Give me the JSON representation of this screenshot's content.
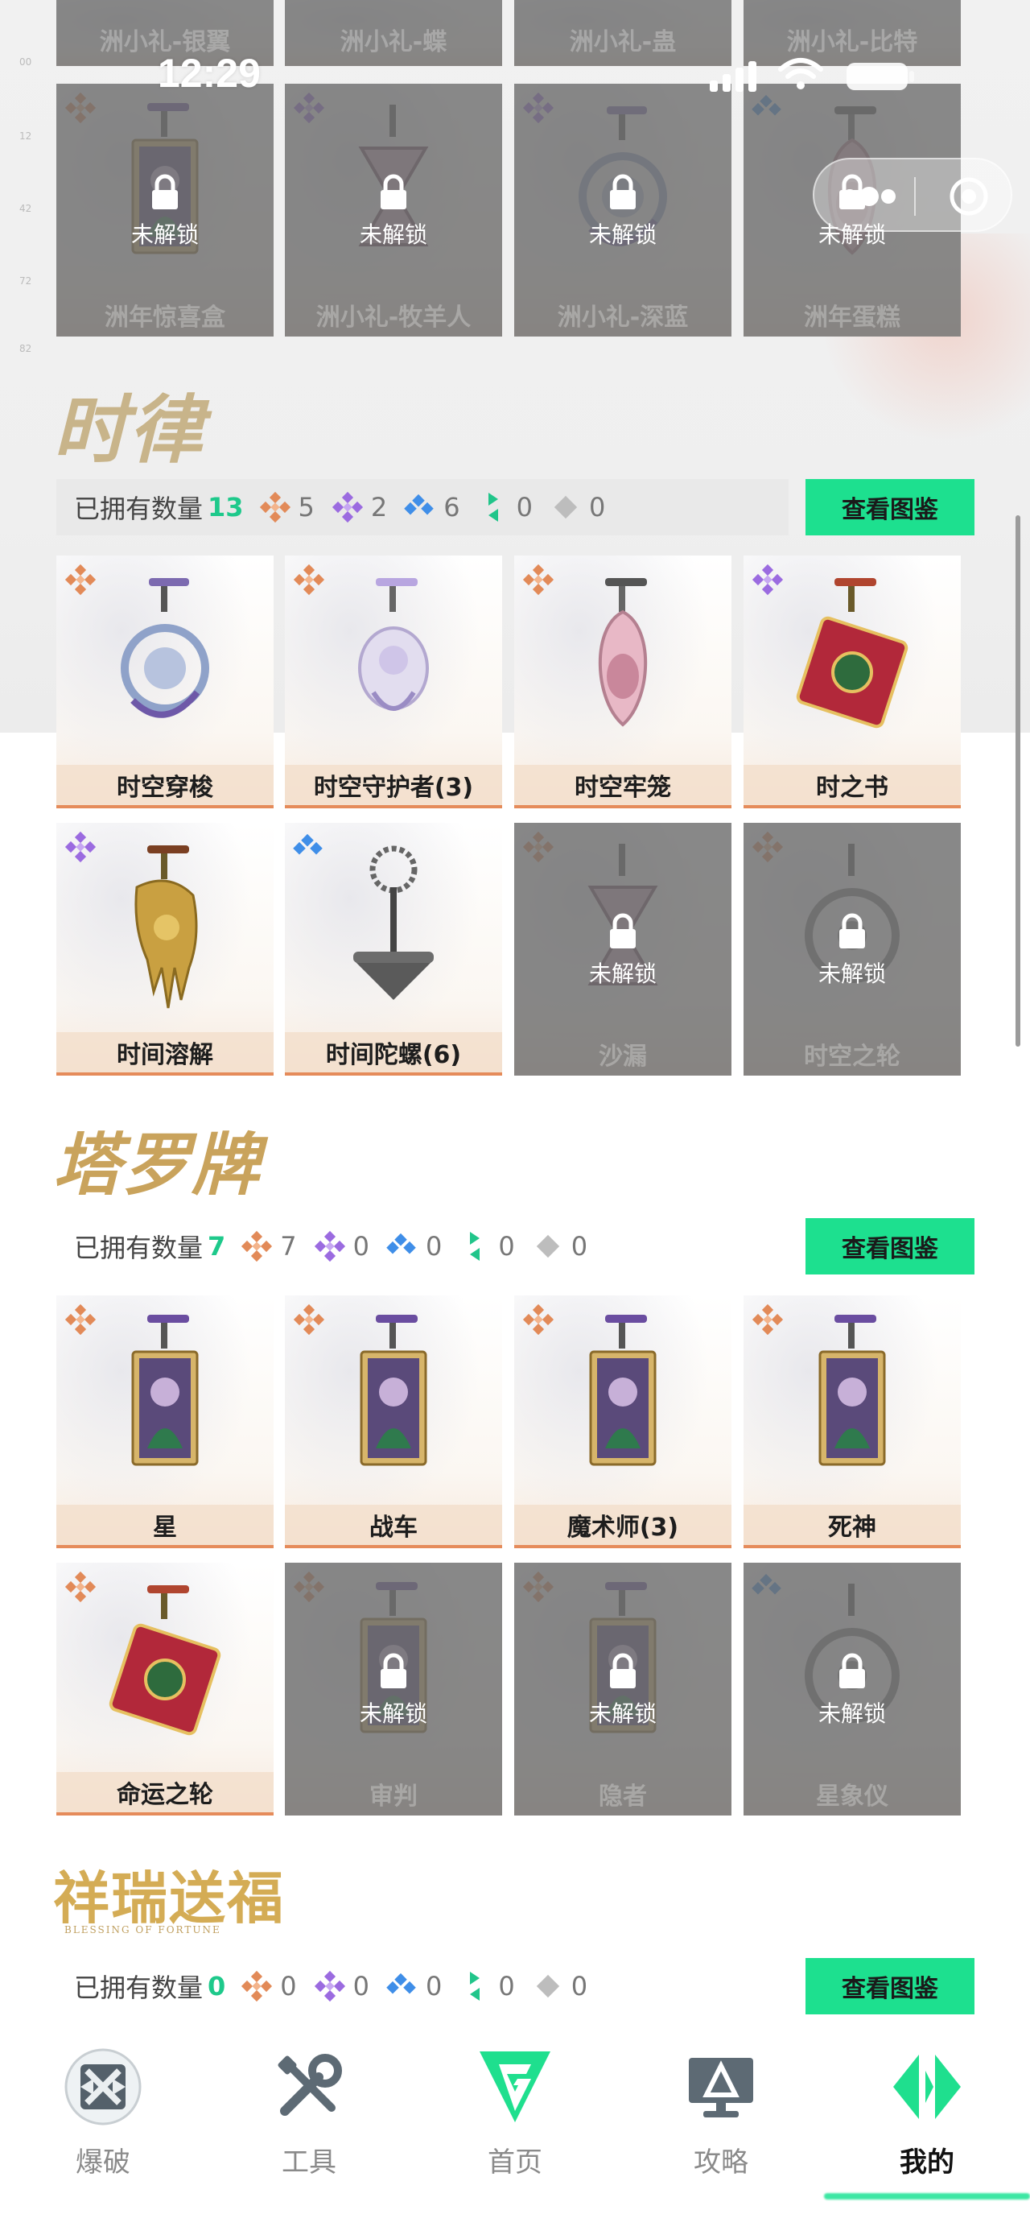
{
  "status": {
    "time": "12:29"
  },
  "top_cards": {
    "row1_names": [
      "洲小礼-银翼",
      "洲小礼-蝶",
      "洲小礼-蛊",
      "洲小礼-比特"
    ],
    "row2": [
      {
        "name": "洲年惊喜盒",
        "lock": "未解锁"
      },
      {
        "name": "洲小礼-牧羊人",
        "lock": "未解锁"
      },
      {
        "name": "洲小礼-深蓝",
        "lock": "未解锁"
      },
      {
        "name": "洲年蛋糕",
        "lock": "未解锁"
      }
    ]
  },
  "sections": [
    {
      "logo_text": "时律",
      "owned_label": "已拥有数量",
      "owned_count": "13",
      "gems": [
        "5",
        "2",
        "6",
        "0",
        "0"
      ],
      "button": "查看图鉴",
      "cards": [
        {
          "name": "时空穿梭",
          "locked": false,
          "lock": ""
        },
        {
          "name": "时空守护者(3)",
          "locked": false,
          "lock": ""
        },
        {
          "name": "时空牢笼",
          "locked": false,
          "lock": ""
        },
        {
          "name": "时之书",
          "locked": false,
          "lock": ""
        },
        {
          "name": "时间溶解",
          "locked": false,
          "lock": ""
        },
        {
          "name": "时间陀螺(6)",
          "locked": false,
          "lock": ""
        },
        {
          "name": "沙漏",
          "locked": true,
          "lock": "未解锁"
        },
        {
          "name": "时空之轮",
          "locked": true,
          "lock": "未解锁"
        }
      ]
    },
    {
      "logo_text": "塔罗牌",
      "owned_label": "已拥有数量",
      "owned_count": "7",
      "gems": [
        "7",
        "0",
        "0",
        "0",
        "0"
      ],
      "button": "查看图鉴",
      "cards": [
        {
          "name": "星",
          "locked": false,
          "lock": ""
        },
        {
          "name": "战车",
          "locked": false,
          "lock": ""
        },
        {
          "name": "魔术师(3)",
          "locked": false,
          "lock": ""
        },
        {
          "name": "死神",
          "locked": false,
          "lock": ""
        },
        {
          "name": "命运之轮",
          "locked": false,
          "lock": ""
        },
        {
          "name": "审判",
          "locked": true,
          "lock": "未解锁"
        },
        {
          "name": "隐者",
          "locked": true,
          "lock": "未解锁"
        },
        {
          "name": "星象仪",
          "locked": true,
          "lock": "未解锁"
        }
      ]
    },
    {
      "logo_text": "祥瑞送福",
      "logo_sub": "BLESSING OF FORTUNE",
      "owned_label": "已拥有数量",
      "owned_count": "0",
      "gems": [
        "0",
        "0",
        "0",
        "0",
        "0"
      ],
      "button": "查看图鉴"
    }
  ],
  "nav": [
    {
      "label": "爆破",
      "icon": "blast-icon"
    },
    {
      "label": "工具",
      "icon": "tools-icon"
    },
    {
      "label": "首页",
      "icon": "home-g-icon"
    },
    {
      "label": "攻略",
      "icon": "guide-monitor-icon"
    },
    {
      "label": "我的",
      "icon": "profile-icon",
      "active": true
    }
  ],
  "colors": {
    "accent": "#1de08f",
    "owned_count": "#1ec98b",
    "name_bar_border": "#e58b5a",
    "gold": "#c9a35c"
  }
}
